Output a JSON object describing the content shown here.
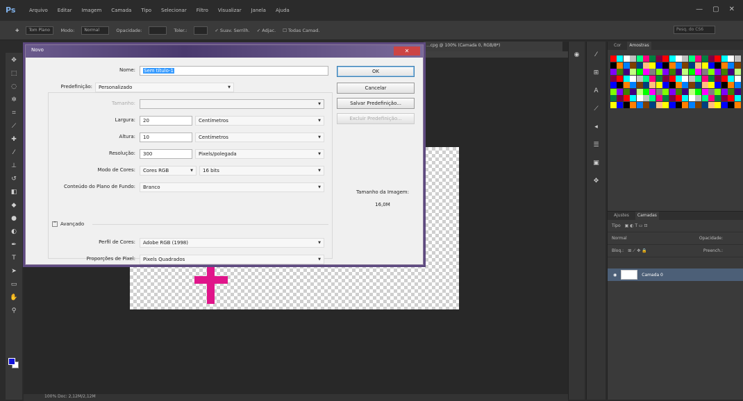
{
  "app": {
    "logo": "Ps",
    "menu": [
      "Arquivo",
      "Editar",
      "Imagem",
      "Camada",
      "Tipo",
      "Selecionar",
      "Filtro",
      "Visualizar",
      "Janela",
      "Ajuda"
    ],
    "window_controls": [
      "—",
      "▢",
      "✕"
    ]
  },
  "options": {
    "tool_icon": "✚",
    "style_label": "Tom Plano",
    "mode_label": "Modo:",
    "mode_value": "Normal",
    "opacity_label": "Opacidade:",
    "tolerance_label": "Toler.:",
    "antialias": "✓ Suav. Serrilh.",
    "contiguous": "✓ Adjac.",
    "all_layers": "☐ Todas Camad.",
    "search_placeholder": "Pesq. do CS6"
  },
  "document": {
    "tab_title": "...cpg @ 100% (Camada 0, RGB/8*)",
    "status_text": "100%   Doc: 2,12M/2,12M"
  },
  "colors": {
    "plus_color": "#e0158a",
    "purple": "#3c1f7e",
    "foreground": "#1414d8"
  },
  "dialog": {
    "title": "Novo",
    "close": "✕",
    "name_label": "Nome:",
    "name_value": "Sem título-1",
    "preset_label": "Predefinição:",
    "preset_value": "Personalizado",
    "size_label": "Tamanho:",
    "width_label": "Largura:",
    "width_value": "20",
    "width_unit": "Centímetros",
    "height_label": "Altura:",
    "height_value": "10",
    "height_unit": "Centímetros",
    "resolution_label": "Resolução:",
    "resolution_value": "300",
    "resolution_unit": "Pixels/polegada",
    "color_mode_label": "Modo de Cores:",
    "color_mode_value": "Cores RGB",
    "bits_value": "16 bits",
    "background_label": "Conteúdo do Plano de Fundo:",
    "background_value": "Branco",
    "advanced_label": "Avançado",
    "profile_label": "Perfil de Cores:",
    "profile_value": "Adobe RGB (1998)",
    "pixel_aspect_label": "Proporções de Pixel:",
    "pixel_aspect_value": "Pixels Quadrados",
    "ok_button": "OK",
    "cancel_button": "Cancelar",
    "save_preset_button": "Salvar Predefinição...",
    "delete_preset_button": "Excluir Predefinição...",
    "image_size_label": "Tamanho da Imagem:",
    "image_size_value": "16,0M"
  },
  "panels": {
    "swatch_tabs": [
      "Cor",
      "Amostras"
    ],
    "layer_tabs": [
      "Ajustes",
      "Camadas"
    ],
    "kind_label": "Tipo",
    "blend_value": "Normal",
    "opacity_label": "Opacidade:",
    "lock_label": "Bloq.:",
    "fill_label": "Preench.:",
    "layer_name": "Camada 0"
  }
}
